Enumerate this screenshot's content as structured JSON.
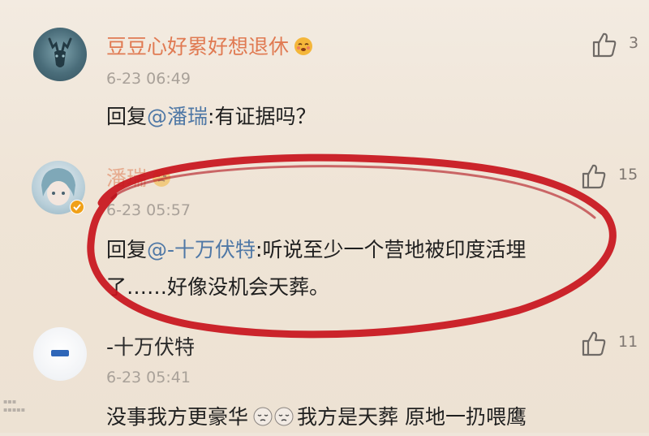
{
  "comments": [
    {
      "username": "豆豆心好累好想退休",
      "timestamp": "6-23 06:49",
      "reply_prefix": "回复",
      "mention": "@潘瑞",
      "reply_body": ":有证据吗？",
      "likes": "3",
      "avatar_icon": "deer-head-icon"
    },
    {
      "username": "潘瑞",
      "timestamp": "6-23 05:57",
      "reply_prefix": "回复",
      "mention": "@-十万伏特",
      "reply_body": ":听说至少一个营地被印度活埋",
      "reply_body_line2": "了……好像没机会天葬。",
      "likes": "15",
      "avatar_icon": "anime-avatar-icon"
    },
    {
      "username": "-十万伏特",
      "timestamp": "6-23 05:41",
      "reply_part1": "没事我方更豪华",
      "reply_part2": "我方是天葬  原地一扔喂鹰",
      "likes": "11",
      "avatar_icon": "dash-avatar-icon"
    }
  ],
  "colors": {
    "username": "#e07a52",
    "mention": "#4f78a6",
    "timestamp": "#a9a199",
    "highlight": "#c8141c",
    "background": "#efe6da"
  }
}
